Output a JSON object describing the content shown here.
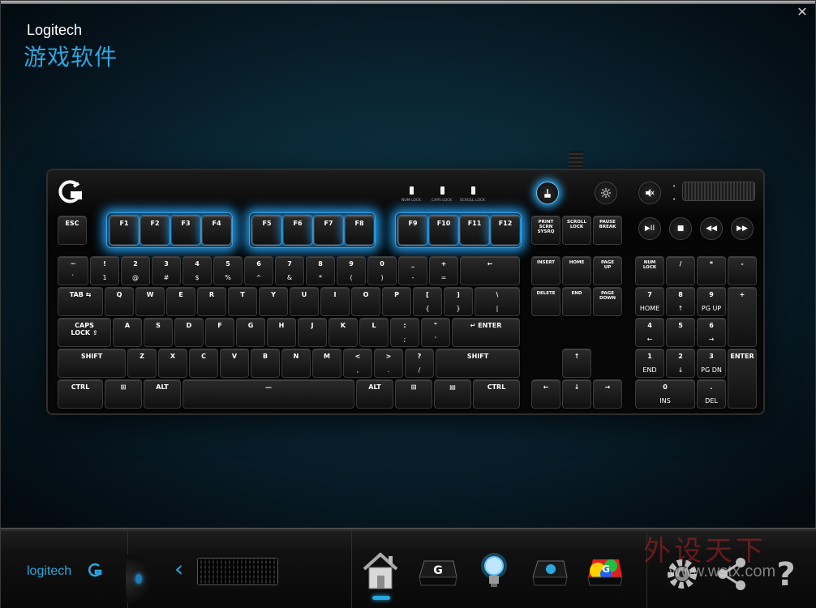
{
  "window": {
    "close_label": "✕"
  },
  "brand": {
    "title": "Logitech",
    "subtitle": "游戏软件"
  },
  "keyboard": {
    "leds": [
      "NUM LOCK",
      "CAPS LOCK",
      "SCROLL LOCK"
    ],
    "top_buttons": [
      "game-mode",
      "backlight",
      "mute"
    ],
    "media": [
      "▶II",
      "■",
      "◀◀",
      "▶▶"
    ],
    "accent": "#29a8e0"
  },
  "bottombar": {
    "logo_text": "logitech",
    "nav": [
      "home",
      "g-keys",
      "lighting",
      "arx",
      "heatmap"
    ],
    "tools": [
      "settings",
      "share",
      "help"
    ],
    "watermark": "外设天下",
    "watermark_url": "www.wstx.com"
  },
  "keys": [
    [
      "ESC",
      "",
      12,
      56,
      36,
      36,
      0
    ],
    [
      "F1",
      "",
      76,
      56,
      36,
      36,
      1
    ],
    [
      "F2",
      "",
      114,
      56,
      36,
      36,
      1
    ],
    [
      "F3",
      "",
      152,
      56,
      36,
      36,
      1
    ],
    [
      "F4",
      "",
      190,
      56,
      36,
      36,
      1
    ],
    [
      "F5",
      "",
      252,
      56,
      36,
      36,
      1
    ],
    [
      "F6",
      "",
      290,
      56,
      36,
      36,
      1
    ],
    [
      "F7",
      "",
      328,
      56,
      36,
      36,
      1
    ],
    [
      "F8",
      "",
      366,
      56,
      36,
      36,
      1
    ],
    [
      "F9",
      "",
      432,
      56,
      36,
      36,
      1
    ],
    [
      "F10",
      "",
      470,
      56,
      36,
      36,
      1
    ],
    [
      "F11",
      "",
      508,
      56,
      36,
      36,
      1
    ],
    [
      "F12",
      "",
      546,
      56,
      36,
      36,
      1
    ],
    [
      "PRINT\nSCRN\nSYSRQ",
      "",
      596,
      56,
      36,
      36,
      2
    ],
    [
      "SCROLL\nLOCK",
      "",
      634,
      56,
      36,
      36,
      2
    ],
    [
      "PAUSE\nBREAK",
      "",
      672,
      56,
      36,
      36,
      2
    ],
    [
      "~",
      "`",
      12,
      106,
      38,
      36,
      0
    ],
    [
      "!",
      "1",
      52,
      106,
      36,
      36,
      0
    ],
    [
      "2",
      "@",
      90,
      106,
      36,
      36,
      0
    ],
    [
      "3",
      "#",
      128,
      106,
      36,
      36,
      0
    ],
    [
      "4",
      "$",
      166,
      106,
      36,
      36,
      0
    ],
    [
      "5",
      "%",
      204,
      106,
      36,
      36,
      0
    ],
    [
      "6",
      "^",
      242,
      106,
      36,
      36,
      0
    ],
    [
      "7",
      "&",
      280,
      106,
      36,
      36,
      0
    ],
    [
      "8",
      "*",
      318,
      106,
      36,
      36,
      0
    ],
    [
      "9",
      "(",
      356,
      106,
      36,
      36,
      0
    ],
    [
      "0",
      ")",
      394,
      106,
      36,
      36,
      0
    ],
    [
      "_",
      "-",
      432,
      106,
      36,
      36,
      0
    ],
    [
      "+",
      "=",
      470,
      106,
      36,
      36,
      0
    ],
    [
      "←",
      "",
      508,
      106,
      74,
      36,
      0
    ],
    [
      "INSERT",
      "",
      596,
      106,
      36,
      36,
      2
    ],
    [
      "HOME",
      "",
      634,
      106,
      36,
      36,
      2
    ],
    [
      "PAGE\nUP",
      "",
      672,
      106,
      36,
      36,
      2
    ],
    [
      "NUM\nLOCK",
      "",
      724,
      106,
      36,
      36,
      2
    ],
    [
      "/",
      "",
      762,
      106,
      36,
      36,
      0
    ],
    [
      "*",
      "",
      800,
      106,
      36,
      36,
      0
    ],
    [
      "-",
      "",
      838,
      106,
      36,
      36,
      0
    ],
    [
      "TAB ⇆",
      "",
      12,
      144,
      56,
      36,
      0
    ],
    [
      "Q",
      "",
      70,
      144,
      36,
      36,
      0
    ],
    [
      "W",
      "",
      108,
      144,
      36,
      36,
      0
    ],
    [
      "E",
      "",
      146,
      144,
      36,
      36,
      0
    ],
    [
      "R",
      "",
      184,
      144,
      36,
      36,
      0
    ],
    [
      "T",
      "",
      222,
      144,
      36,
      36,
      0
    ],
    [
      "Y",
      "",
      260,
      144,
      36,
      36,
      0
    ],
    [
      "U",
      "",
      298,
      144,
      36,
      36,
      0
    ],
    [
      "I",
      "",
      336,
      144,
      36,
      36,
      0
    ],
    [
      "O",
      "",
      374,
      144,
      36,
      36,
      0
    ],
    [
      "P",
      "",
      412,
      144,
      36,
      36,
      0
    ],
    [
      "[",
      "{",
      450,
      144,
      36,
      36,
      0
    ],
    [
      "]",
      "}",
      488,
      144,
      36,
      36,
      0
    ],
    [
      "\\",
      "|",
      526,
      144,
      56,
      36,
      0
    ],
    [
      "DELETE",
      "",
      596,
      144,
      36,
      36,
      2
    ],
    [
      "END",
      "",
      634,
      144,
      36,
      36,
      2
    ],
    [
      "PAGE\nDOWN",
      "",
      672,
      144,
      36,
      36,
      2
    ],
    [
      "7",
      "HOME",
      724,
      144,
      36,
      36,
      0
    ],
    [
      "8",
      "↑",
      762,
      144,
      36,
      36,
      0
    ],
    [
      "9",
      "PG UP",
      800,
      144,
      36,
      36,
      0
    ],
    [
      "+",
      "",
      838,
      144,
      36,
      74,
      0
    ],
    [
      "CAPS\nLOCK ⇪",
      "",
      12,
      182,
      66,
      36,
      0
    ],
    [
      "A",
      "",
      80,
      182,
      36,
      36,
      0
    ],
    [
      "S",
      "",
      118,
      182,
      36,
      36,
      0
    ],
    [
      "D",
      "",
      156,
      182,
      36,
      36,
      0
    ],
    [
      "F",
      "",
      194,
      182,
      36,
      36,
      0
    ],
    [
      "G",
      "",
      232,
      182,
      36,
      36,
      0
    ],
    [
      "H",
      "",
      270,
      182,
      36,
      36,
      0
    ],
    [
      "J",
      "",
      308,
      182,
      36,
      36,
      0
    ],
    [
      "K",
      "",
      346,
      182,
      36,
      36,
      0
    ],
    [
      "L",
      "",
      384,
      182,
      36,
      36,
      0
    ],
    [
      ":",
      ";",
      422,
      182,
      36,
      36,
      0
    ],
    [
      "\"",
      "'",
      460,
      182,
      36,
      36,
      0
    ],
    [
      "↵ ENTER",
      "",
      498,
      182,
      84,
      36,
      0
    ],
    [
      "4",
      "←",
      724,
      182,
      36,
      36,
      0
    ],
    [
      "5",
      "",
      762,
      182,
      36,
      36,
      0
    ],
    [
      "6",
      "→",
      800,
      182,
      36,
      36,
      0
    ],
    [
      "SHIFT",
      "",
      12,
      220,
      84,
      36,
      0
    ],
    [
      "Z",
      "",
      98,
      220,
      36,
      36,
      0
    ],
    [
      "X",
      "",
      136,
      220,
      36,
      36,
      0
    ],
    [
      "C",
      "",
      174,
      220,
      36,
      36,
      0
    ],
    [
      "V",
      "",
      212,
      220,
      36,
      36,
      0
    ],
    [
      "B",
      "",
      250,
      220,
      36,
      36,
      0
    ],
    [
      "N",
      "",
      288,
      220,
      36,
      36,
      0
    ],
    [
      "M",
      "",
      326,
      220,
      36,
      36,
      0
    ],
    [
      "<",
      ",",
      364,
      220,
      36,
      36,
      0
    ],
    [
      ">",
      ".",
      402,
      220,
      36,
      36,
      0
    ],
    [
      "?",
      "/",
      440,
      220,
      36,
      36,
      0
    ],
    [
      "SHIFT",
      "",
      478,
      220,
      104,
      36,
      0
    ],
    [
      "↑",
      "",
      634,
      220,
      36,
      36,
      0
    ],
    [
      "1",
      "END",
      724,
      220,
      36,
      36,
      0
    ],
    [
      "2",
      "↓",
      762,
      220,
      36,
      36,
      0
    ],
    [
      "3",
      "PG DN",
      800,
      220,
      36,
      36,
      0
    ],
    [
      "ENTER",
      "",
      838,
      220,
      36,
      74,
      0
    ],
    [
      "CTRL",
      "",
      12,
      258,
      56,
      36,
      0
    ],
    [
      "⊞",
      "",
      70,
      258,
      46,
      36,
      0
    ],
    [
      "ALT",
      "",
      118,
      258,
      46,
      36,
      0
    ],
    [
      "—",
      "",
      166,
      258,
      212,
      36,
      0
    ],
    [
      "ALT",
      "",
      380,
      258,
      46,
      36,
      0
    ],
    [
      "⊞",
      "",
      428,
      258,
      46,
      36,
      0
    ],
    [
      "▤",
      "",
      476,
      258,
      46,
      36,
      0
    ],
    [
      "CTRL",
      "",
      524,
      258,
      58,
      36,
      0
    ],
    [
      "←",
      "",
      596,
      258,
      36,
      36,
      0
    ],
    [
      "↓",
      "",
      634,
      258,
      36,
      36,
      0
    ],
    [
      "→",
      "",
      672,
      258,
      36,
      36,
      0
    ],
    [
      "0",
      "INS",
      724,
      258,
      74,
      36,
      0
    ],
    [
      ".",
      "DEL",
      800,
      258,
      36,
      36,
      0
    ]
  ]
}
